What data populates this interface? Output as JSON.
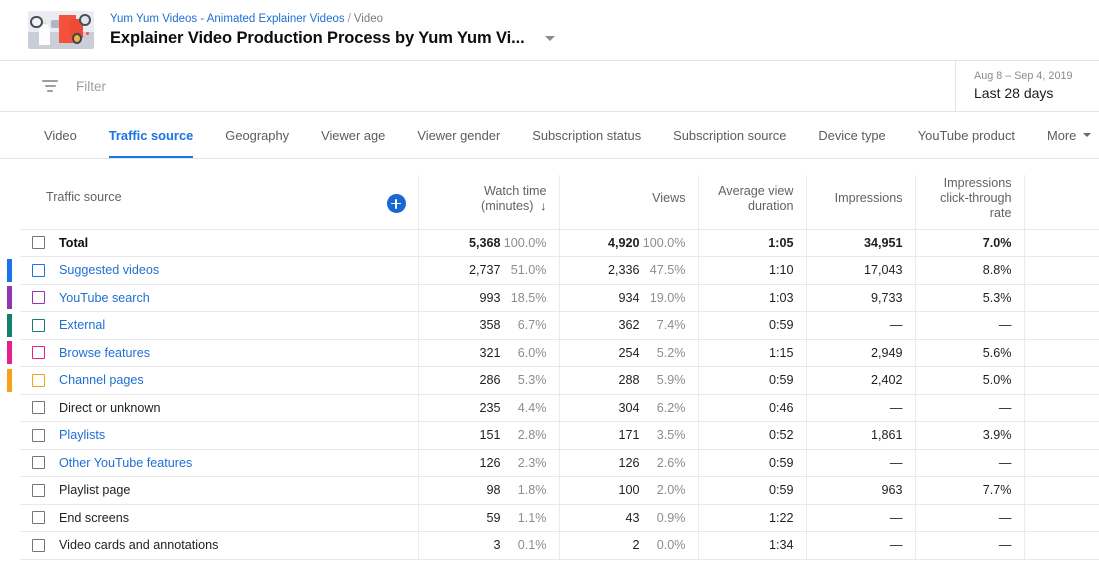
{
  "header": {
    "breadcrumb_channel": "Yum Yum Videos - Animated Explainer Videos",
    "breadcrumb_sep": "/",
    "breadcrumb_current": "Video",
    "video_title": "Explainer Video Production Process by Yum Yum Vi...",
    "dropdown_icon": "chevron-down-icon",
    "thumbnail_icon": "video-thumbnail"
  },
  "filter_bar": {
    "icon": "filter-funnel-icon",
    "placeholder": "Filter",
    "date_range": "Aug 8 – Sep 4, 2019",
    "date_label": "Last 28 days"
  },
  "tabs": [
    {
      "label": "Video",
      "active": false
    },
    {
      "label": "Traffic source",
      "active": true
    },
    {
      "label": "Geography",
      "active": false
    },
    {
      "label": "Viewer age",
      "active": false
    },
    {
      "label": "Viewer gender",
      "active": false
    },
    {
      "label": "Subscription status",
      "active": false
    },
    {
      "label": "Subscription source",
      "active": false
    },
    {
      "label": "Device type",
      "active": false
    },
    {
      "label": "YouTube product",
      "active": false
    },
    {
      "label": "More",
      "active": false,
      "caret": true
    }
  ],
  "table": {
    "add_metric_icon": "add-circle-icon",
    "sort_icon": "arrow-down-icon",
    "columns": {
      "name": "Traffic source",
      "watch_time": "Watch time",
      "watch_time_unit": "(minutes)",
      "views": "Views",
      "avg_view_duration_l1": "Average view",
      "avg_view_duration_l2": "duration",
      "impressions": "Impressions",
      "ctr_l1": "Impressions",
      "ctr_l2": "click-through",
      "ctr_l3": "rate"
    },
    "rows": [
      {
        "label": "Total",
        "total": true,
        "link": false,
        "color": null,
        "watch_time": "5,368",
        "watch_pct": "100.0%",
        "views": "4,920",
        "views_pct": "100.0%",
        "avg_duration": "1:05",
        "impressions": "34,951",
        "ctr": "7.0%"
      },
      {
        "label": "Suggested videos",
        "total": false,
        "link": true,
        "color": "#1a73e8",
        "watch_time": "2,737",
        "watch_pct": "51.0%",
        "views": "2,336",
        "views_pct": "47.5%",
        "avg_duration": "1:10",
        "impressions": "17,043",
        "ctr": "8.8%"
      },
      {
        "label": "YouTube search",
        "total": false,
        "link": true,
        "color": "#9334b0",
        "watch_time": "993",
        "watch_pct": "18.5%",
        "views": "934",
        "views_pct": "19.0%",
        "avg_duration": "1:03",
        "impressions": "9,733",
        "ctr": "5.3%"
      },
      {
        "label": "External",
        "total": false,
        "link": true,
        "color": "#12806a",
        "watch_time": "358",
        "watch_pct": "6.7%",
        "views": "362",
        "views_pct": "7.4%",
        "avg_duration": "0:59",
        "impressions": "—",
        "ctr": "—"
      },
      {
        "label": "Browse features",
        "total": false,
        "link": true,
        "color": "#e8218a",
        "watch_time": "321",
        "watch_pct": "6.0%",
        "views": "254",
        "views_pct": "5.2%",
        "avg_duration": "1:15",
        "impressions": "2,949",
        "ctr": "5.6%"
      },
      {
        "label": "Channel pages",
        "total": false,
        "link": true,
        "color": "#f9a01b",
        "watch_time": "286",
        "watch_pct": "5.3%",
        "views": "288",
        "views_pct": "5.9%",
        "avg_duration": "0:59",
        "impressions": "2,402",
        "ctr": "5.0%"
      },
      {
        "label": "Direct or unknown",
        "total": false,
        "link": false,
        "color": null,
        "watch_time": "235",
        "watch_pct": "4.4%",
        "views": "304",
        "views_pct": "6.2%",
        "avg_duration": "0:46",
        "impressions": "—",
        "ctr": "—"
      },
      {
        "label": "Playlists",
        "total": false,
        "link": true,
        "color": null,
        "watch_time": "151",
        "watch_pct": "2.8%",
        "views": "171",
        "views_pct": "3.5%",
        "avg_duration": "0:52",
        "impressions": "1,861",
        "ctr": "3.9%"
      },
      {
        "label": "Other YouTube features",
        "total": false,
        "link": true,
        "color": null,
        "watch_time": "126",
        "watch_pct": "2.3%",
        "views": "126",
        "views_pct": "2.6%",
        "avg_duration": "0:59",
        "impressions": "—",
        "ctr": "—"
      },
      {
        "label": "Playlist page",
        "total": false,
        "link": false,
        "color": null,
        "watch_time": "98",
        "watch_pct": "1.8%",
        "views": "100",
        "views_pct": "2.0%",
        "avg_duration": "0:59",
        "impressions": "963",
        "ctr": "7.7%"
      },
      {
        "label": "End screens",
        "total": false,
        "link": false,
        "color": null,
        "watch_time": "59",
        "watch_pct": "1.1%",
        "views": "43",
        "views_pct": "0.9%",
        "avg_duration": "1:22",
        "impressions": "—",
        "ctr": "—"
      },
      {
        "label": "Video cards and annotations",
        "total": false,
        "link": false,
        "color": null,
        "watch_time": "3",
        "watch_pct": "0.1%",
        "views": "2",
        "views_pct": "0.0%",
        "avg_duration": "1:34",
        "impressions": "—",
        "ctr": "—"
      }
    ]
  },
  "colors": {
    "accent": "#1a73e8",
    "link": "#1f6fd4",
    "muted": "#8d8d8d"
  }
}
